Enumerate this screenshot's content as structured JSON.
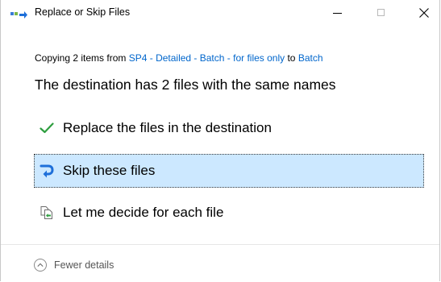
{
  "window": {
    "title": "Replace or Skip Files",
    "minimize_label": "Minimize",
    "maximize_label": "Maximize",
    "close_label": "Close"
  },
  "copying": {
    "prefix": "Copying 2 items from ",
    "source": "SP4 - Detailed - Batch - for files only",
    "middle": " to ",
    "destination": "Batch"
  },
  "heading": "The destination has 2 files with the same names",
  "options": [
    {
      "label": "Replace the files in the destination",
      "icon": "checkmark-icon"
    },
    {
      "label": "Skip these files",
      "icon": "skip-arrow-icon",
      "selected": true
    },
    {
      "label": "Let me decide for each file",
      "icon": "file-compare-icon"
    }
  ],
  "footer": {
    "details_label": "Fewer details",
    "icon": "chevron-up-icon"
  },
  "colors": {
    "link": "#0066cc",
    "selected_bg": "#cce8ff",
    "check_green": "#2e9e3f",
    "skip_blue": "#1e6fd9"
  }
}
